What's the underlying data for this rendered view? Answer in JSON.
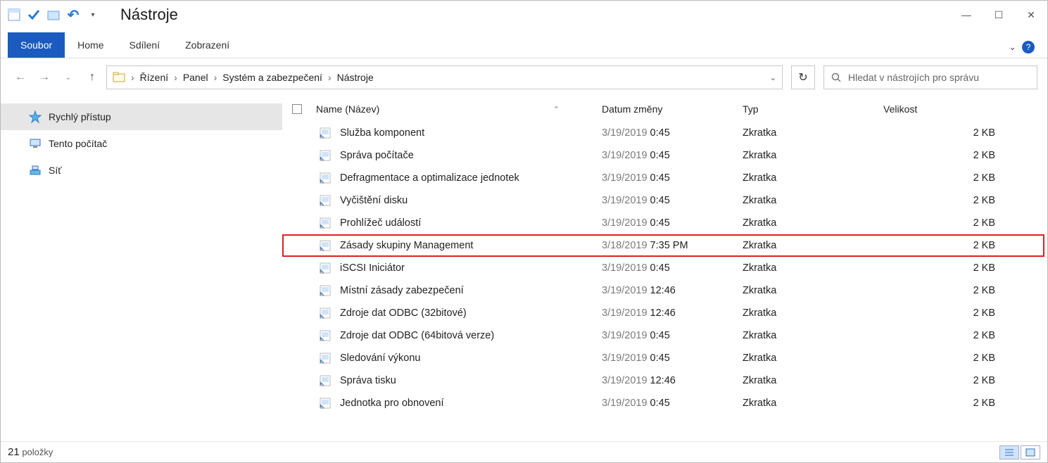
{
  "window": {
    "title": "Nástroje"
  },
  "tabs": {
    "file": "Soubor",
    "home": "Home",
    "share": "Sdílení",
    "view": "Zobrazení"
  },
  "breadcrumb": {
    "parts": [
      "Řízení",
      "Panel",
      "Systém a zabezpečení",
      "Nástroje"
    ]
  },
  "search": {
    "placeholder": "Hledat v nástrojích pro správu"
  },
  "sidebar": {
    "items": [
      {
        "icon": "star",
        "label": "Rychlý přístup",
        "selected": true
      },
      {
        "icon": "pc",
        "label": "Tento počítač",
        "selected": false
      },
      {
        "icon": "network",
        "label": "Síť",
        "selected": false
      }
    ]
  },
  "columns": {
    "name": "Name (Název)",
    "date": "Datum změny",
    "type": "Typ",
    "size": "Velikost"
  },
  "type_label": "Zkratka",
  "size_label": "2 KB",
  "status": {
    "count": "21",
    "label": "položky"
  },
  "rows": [
    {
      "name": "Služba komponent",
      "date": "3/19/2019",
      "time": "0:45",
      "highlight": false
    },
    {
      "name": "Správa počítače",
      "date": "3/19/2019",
      "time": "0:45",
      "highlight": false
    },
    {
      "name": "Defragmentace a optimalizace jednotek",
      "date": "3/19/2019",
      "time": "0:45",
      "highlight": false
    },
    {
      "name": "Vyčištění disku",
      "date": "3/19/2019",
      "time": "0:45",
      "highlight": false
    },
    {
      "name": "Prohlížeč událostí",
      "date": "3/19/2019",
      "time": "0:45",
      "highlight": false
    },
    {
      "name": "Zásady skupiny Management",
      "date": "3/18/2019",
      "time": "7:35 PM",
      "highlight": true
    },
    {
      "name": "iSCSI Iniciátor",
      "date": "3/19/2019",
      "time": "0:45",
      "highlight": false
    },
    {
      "name": "Místní zásady zabezpečení",
      "date": "3/19/2019",
      "time": "12:46",
      "highlight": false
    },
    {
      "name": "Zdroje dat ODBC (32bitové)",
      "date": "3/19/2019",
      "time": "12:46",
      "highlight": false
    },
    {
      "name": "Zdroje dat ODBC (64bitová verze)",
      "date": "3/19/2019",
      "time": "0:45",
      "highlight": false
    },
    {
      "name": "Sledování výkonu",
      "date": "3/19/2019",
      "time": "0:45",
      "highlight": false
    },
    {
      "name": "Správa tisku",
      "date": "3/19/2019",
      "time": "12:46",
      "highlight": false
    },
    {
      "name": "Jednotka pro obnovení",
      "date": "3/19/2019",
      "time": "0:45",
      "highlight": false
    }
  ]
}
